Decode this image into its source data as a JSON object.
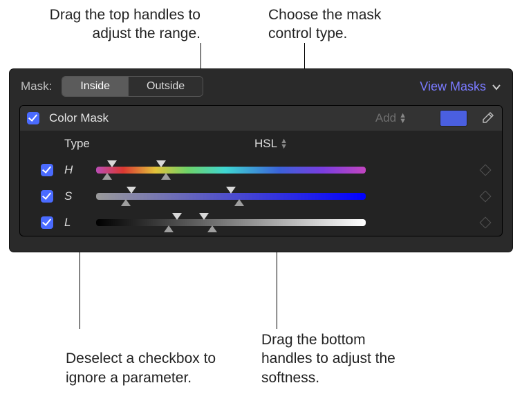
{
  "callouts": {
    "top_left": "Drag the top handles to adjust the range.",
    "top_right": "Choose the mask control type.",
    "bottom_left": "Deselect a checkbox to ignore a parameter.",
    "bottom_right": "Drag the bottom handles to adjust the softness."
  },
  "panel": {
    "mask_label": "Mask:",
    "seg_inside": "Inside",
    "seg_outside": "Outside",
    "view_masks": "View Masks"
  },
  "color_mask": {
    "title": "Color Mask",
    "add_label": "Add",
    "type_label": "Type",
    "type_value": "HSL",
    "swatch_color": "#4a5fe0"
  },
  "params": {
    "h": {
      "label": "H"
    },
    "s": {
      "label": "S"
    },
    "l": {
      "label": "L"
    }
  }
}
